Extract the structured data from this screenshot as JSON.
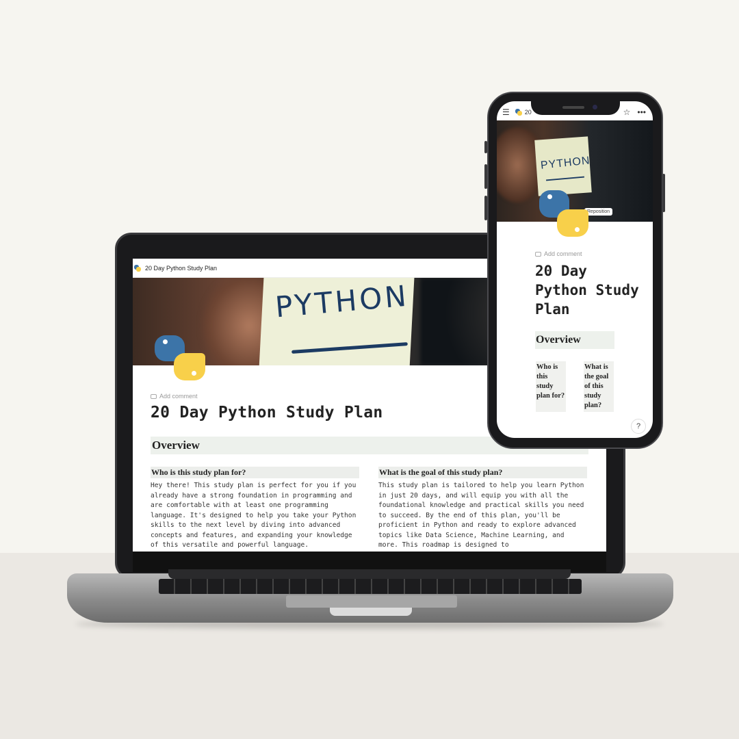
{
  "laptop": {
    "tab_title": "20 Day Python Study Plan",
    "cover_text": "PYTHON",
    "add_comment": "Add comment",
    "page_title": "20 Day Python Study Plan",
    "overview_heading": "Overview",
    "columns": [
      {
        "heading": "Who is this study plan for?",
        "body": "Hey there! This study plan is perfect for you if you already have a strong foundation in programming and are comfortable with at least one programming language. It's designed to help you take your Python skills to the next level by diving into advanced concepts and features, and expanding your knowledge of this versatile and powerful language."
      },
      {
        "heading": "What is the goal of this study plan?",
        "body": "This study plan is tailored to help you learn Python in just 20 days, and  will equip you with all the foundational knowledge and practical skills you need to succeed. By the end of this plan, you'll be proficient in Python and ready to explore advanced topics like Data Science, Machine Learning, and more. This roadmap is designed to"
      }
    ]
  },
  "phone": {
    "tab_title": "20",
    "cover_text": "PYTHON",
    "reposition": "Reposition",
    "add_comment": "Add comment",
    "page_title": "20 Day Python Study Plan",
    "overview_heading": "Overview",
    "columns": [
      {
        "heading": "Who is this study plan for?"
      },
      {
        "heading": "What is the goal of this study plan?"
      }
    ],
    "help": "?"
  },
  "icons": {
    "menu": "hamburger-icon",
    "star": "star-icon",
    "more": "more-icon",
    "comment": "comment-icon",
    "logo": "python-logo-icon"
  },
  "colors": {
    "python_blue": "#3c74a8",
    "python_yellow": "#f8d04a",
    "note_ink": "#1c3b63",
    "heading_bg": "#edf1ec"
  }
}
